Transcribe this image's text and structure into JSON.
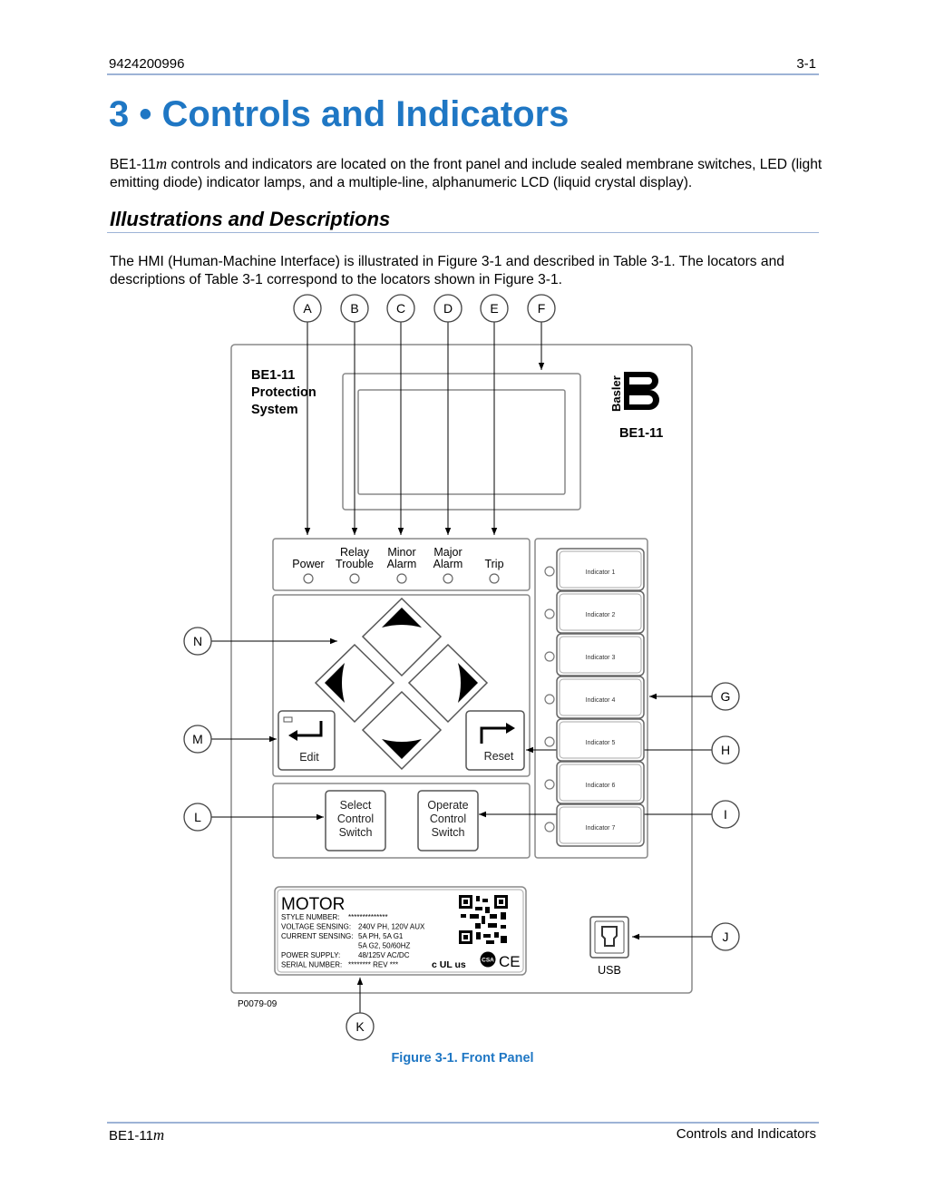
{
  "header": {
    "doc_number": "9424200996",
    "page_number": "3-1"
  },
  "title": "3 • Controls and Indicators",
  "intro": {
    "product_prefix": "BE1-11",
    "product_suffix": "m",
    "text": " controls and indicators are located on the front panel and include sealed membrane switches, LED (light emitting diode) indicator lamps, and a multiple-line, alphanumeric LCD (liquid crystal display)."
  },
  "section_heading": "Illustrations and Descriptions",
  "section_text": "The HMI (Human-Machine Interface) is illustrated in Figure 3-1 and described in Table 3-1. The locators and descriptions of Table 3-1 correspond to the locators shown in Figure 3-1.",
  "figure": {
    "panel_title": [
      "BE1-11",
      "Protection",
      "System"
    ],
    "brand": "Basler",
    "model": "BE1-11",
    "leds": [
      {
        "line1": "",
        "line2": "Power"
      },
      {
        "line1": "Relay",
        "line2": "Trouble"
      },
      {
        "line1": "Minor",
        "line2": "Alarm"
      },
      {
        "line1": "Major",
        "line2": "Alarm"
      },
      {
        "line1": "",
        "line2": "Trip"
      }
    ],
    "edit_label": "Edit",
    "reset_label": "Reset",
    "select_switch": [
      "Select",
      "Control",
      "Switch"
    ],
    "operate_switch": [
      "Operate",
      "Control",
      "Switch"
    ],
    "indicators": [
      "Indicator 1",
      "Indicator 2",
      "Indicator 3",
      "Indicator 4",
      "Indicator 5",
      "Indicator 6",
      "Indicator 7"
    ],
    "plate": {
      "title": "MOTOR",
      "lines": [
        {
          "label": "STYLE NUMBER:",
          "value": "**************"
        },
        {
          "label": "VOLTAGE SENSING:",
          "value": "240V PH, 120V AUX"
        },
        {
          "label": "CURRENT SENSING:",
          "value": "5A PH, 5A G1"
        },
        {
          "label": "",
          "value": "5A G2, 50/60HZ"
        },
        {
          "label": "POWER SUPPLY:",
          "value": "48/125V AC/DC"
        },
        {
          "label": "SERIAL NUMBER:",
          "value": "********   REV ***"
        }
      ],
      "cert_marks": [
        "c UL us",
        "CSA",
        "CE"
      ]
    },
    "usb_label": "USB",
    "drawing_id": "P0079-09",
    "callouts": {
      "A": "A",
      "B": "B",
      "C": "C",
      "D": "D",
      "E": "E",
      "F": "F",
      "G": "G",
      "H": "H",
      "I": "I",
      "J": "J",
      "K": "K",
      "L": "L",
      "M": "M",
      "N": "N"
    },
    "caption": "Figure 3-1. Front Panel"
  },
  "footer": {
    "product_prefix": "BE1-11",
    "product_suffix": "m",
    "section": "Controls and Indicators"
  },
  "colors": {
    "accent": "#1f77c4",
    "rule": "#9db3d6"
  }
}
